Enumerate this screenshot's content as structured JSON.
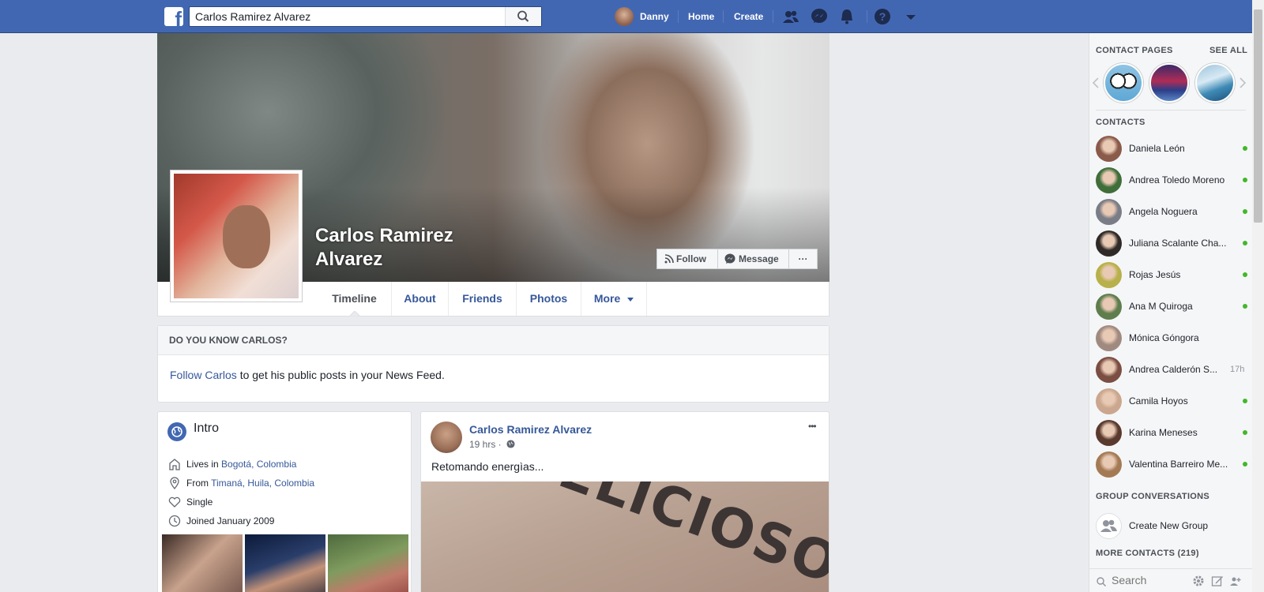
{
  "topbar": {
    "logo_letter": "f",
    "search_value": "Carlos Ramirez Alvarez",
    "user_name": "Danny",
    "home_label": "Home",
    "create_label": "Create"
  },
  "profile": {
    "name": "Carlos Ramirez Alvarez",
    "follow_label": "Follow",
    "message_label": "Message",
    "more_dots": "···",
    "tabs": [
      "Timeline",
      "About",
      "Friends",
      "Photos",
      "More"
    ]
  },
  "know": {
    "heading": "DO YOU KNOW CARLOS?",
    "link": "Follow Carlos",
    "text": " to get his public posts in your News Feed."
  },
  "intro": {
    "title": "Intro",
    "lives_prefix": "Lives in ",
    "lives_city": "Bogotá, Colombia",
    "from_prefix": "From ",
    "from_city": "Timaná, Huila, Colombia",
    "status": "Single",
    "joined": "Joined January 2009"
  },
  "post": {
    "author": "Carlos Ramirez Alvarez",
    "time": "19 hrs ·",
    "text": "Retomando energìas...",
    "image_text": "DELICIOSO",
    "menu_dots": "•••"
  },
  "sidebar": {
    "contact_pages_label": "CONTACT PAGES",
    "see_all_label": "SEE ALL",
    "contacts_label": "CONTACTS",
    "contacts": [
      {
        "name": "Daniela León",
        "status": "online",
        "color": "#8a5a4a"
      },
      {
        "name": "Andrea Toledo Moreno",
        "status": "online",
        "color": "#3f6e3a"
      },
      {
        "name": "Angela Noguera",
        "status": "online",
        "color": "#7a7c86"
      },
      {
        "name": "Juliana Scalante Cha...",
        "status": "online",
        "color": "#2f2a27"
      },
      {
        "name": "Rojas Jesús",
        "status": "online",
        "color": "#b8b04a"
      },
      {
        "name": "Ana M Quiroga",
        "status": "online",
        "color": "#5f7d4d"
      },
      {
        "name": "Mónica Góngora",
        "status": "offline",
        "color": "#a08a80"
      },
      {
        "name": "Andrea Calderón S...",
        "status": "17h",
        "color": "#7a4e42"
      },
      {
        "name": "Camila Hoyos",
        "status": "online",
        "color": "#caa78e"
      },
      {
        "name": "Karina Meneses",
        "status": "online",
        "color": "#5a3a2e"
      },
      {
        "name": "Valentina Barreiro Me...",
        "status": "online",
        "color": "#a47a55"
      }
    ],
    "group_label": "GROUP CONVERSATIONS",
    "create_group_label": "Create New Group",
    "more_contacts_label": "MORE CONTACTS (219)",
    "search_placeholder": "Search"
  },
  "colors": {
    "brand": "#4267b2",
    "link": "#365899",
    "online": "#42b72a"
  }
}
